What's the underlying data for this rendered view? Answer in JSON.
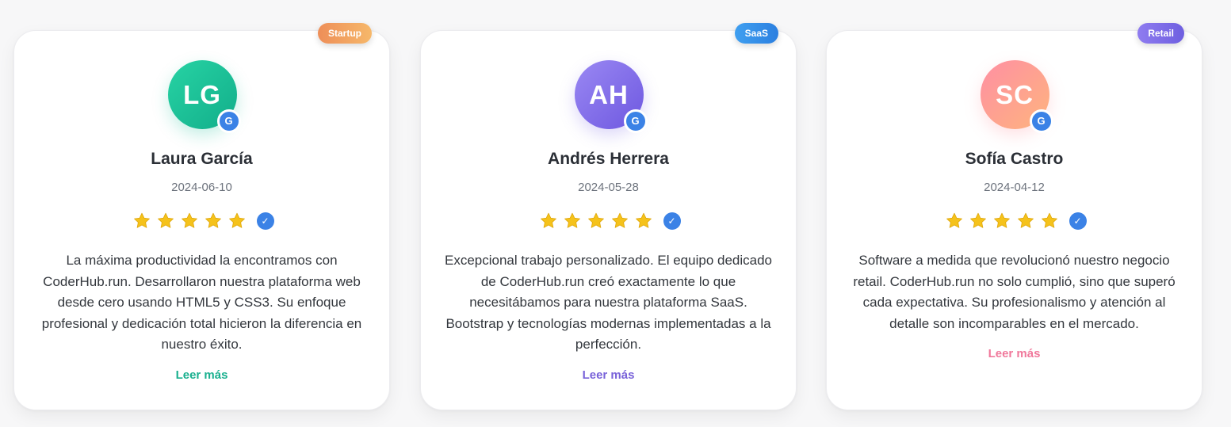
{
  "testimonials": [
    {
      "badge": "Startup",
      "initials": "LG",
      "google_badge": "G",
      "name": "Laura García",
      "date": "2024-06-10",
      "rating": 5,
      "verified_icon": "✓",
      "text": "La máxima productividad la encontramos con CoderHub.run. Desarrollaron nuestra plataforma web desde cero usando HTML5 y CSS3. Su enfoque profesional y dedicación total hicieron la diferencia en nuestro éxito.",
      "read_more": "Leer más",
      "accent": "#1ab08f"
    },
    {
      "badge": "SaaS",
      "initials": "AH",
      "google_badge": "G",
      "name": "Andrés Herrera",
      "date": "2024-05-28",
      "rating": 5,
      "verified_icon": "✓",
      "text": "Excepcional trabajo personalizado. El equipo dedicado de CoderHub.run creó exactamente lo que necesitábamos para nuestra plataforma SaaS. Bootstrap y tecnologías modernas implementadas a la perfección.",
      "read_more": "Leer más",
      "accent": "#7862d9"
    },
    {
      "badge": "Retail",
      "initials": "SC",
      "google_badge": "G",
      "name": "Sofía Castro",
      "date": "2024-04-12",
      "rating": 5,
      "verified_icon": "✓",
      "text": "Software a medida que revolucionó nuestro negocio retail. CoderHub.run no solo cumplió, sino que superó cada expectativa. Su profesionalismo y atención al detalle son incomparables en el mercado.",
      "read_more": "Leer más",
      "accent": "#f0789b"
    }
  ],
  "colors": {
    "star": "#f5c21b",
    "verified": "#3b82e6"
  }
}
